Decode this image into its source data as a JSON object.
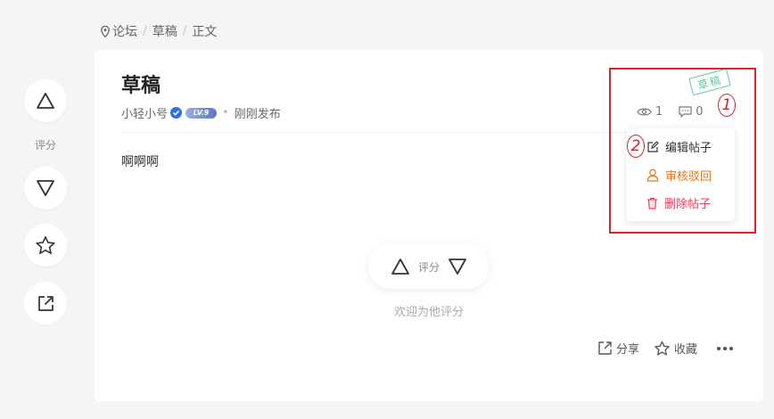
{
  "breadcrumb": {
    "items": [
      "论坛",
      "草稿",
      "正文"
    ],
    "separator": "/"
  },
  "sidebar": {
    "rating_label": "评分"
  },
  "post": {
    "title": "草稿",
    "author": "小轻小号",
    "level": "LV.9",
    "time": "刚刚发布",
    "content": "啊啊啊",
    "stamp": "草稿",
    "views": "1",
    "comments": "0"
  },
  "menu": {
    "edit": "编辑帖子",
    "review_reject": "审核驳回",
    "delete": "删除帖子"
  },
  "annotations": {
    "one": "1",
    "two": "2"
  },
  "rating": {
    "label": "评分",
    "hint": "欢迎为他评分"
  },
  "actions": {
    "share": "分享",
    "favorite": "收藏"
  },
  "colors": {
    "primary_text": "#222222",
    "review_orange": "#e8741c",
    "delete_red": "#e8405a",
    "stamp_green": "#5ecc9c",
    "verified_blue": "#2f6fe4",
    "highlight_red": "#d9262c"
  }
}
